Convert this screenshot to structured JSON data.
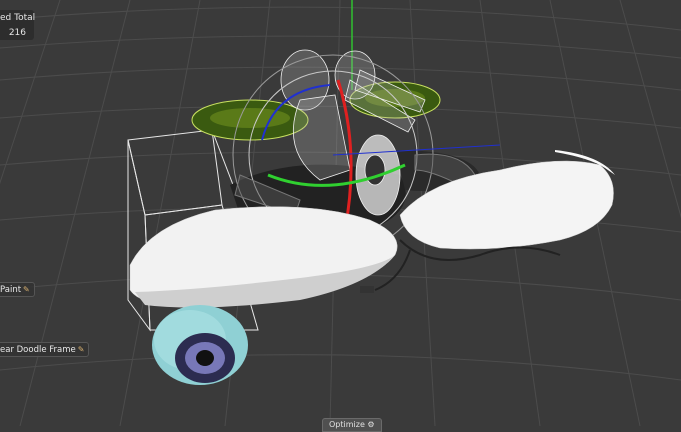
{
  "stats": {
    "label": "ed Total",
    "value": "216"
  },
  "layer_tags": [
    {
      "label": "Paint",
      "icon": "brush-icon"
    },
    {
      "label": "ear Doodle Frame",
      "icon": "brush-icon"
    }
  ],
  "bottom_button": {
    "label": "Optimize",
    "icon": "gear-icon"
  },
  "colors": {
    "background": "#3a3a3a",
    "grid": "#4a4a4a",
    "axis_x": "#e02020",
    "axis_y": "#30d030",
    "axis_z": "#2030d0"
  }
}
